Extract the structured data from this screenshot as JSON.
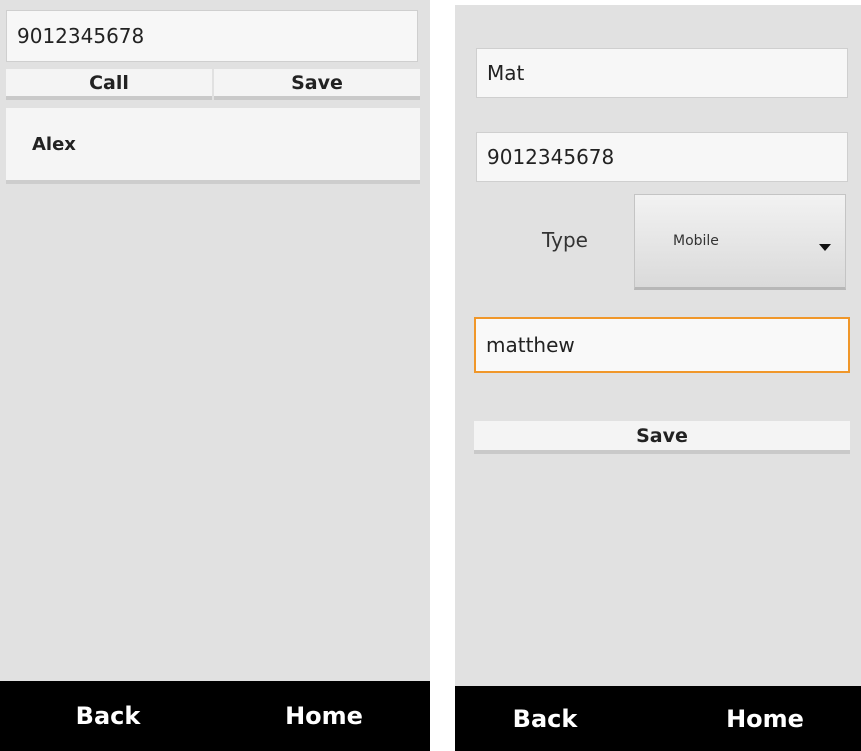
{
  "left_screen": {
    "phone_input": {
      "value": "9012345678"
    },
    "call_button": {
      "label": "Call"
    },
    "save_button": {
      "label": "Save"
    },
    "contacts": [
      {
        "name": "Alex"
      }
    ],
    "nav": {
      "back_label": "Back",
      "home_label": "Home"
    }
  },
  "right_screen": {
    "name_input": {
      "value": "Mat"
    },
    "phone_input": {
      "value": "9012345678"
    },
    "type_label": "Type",
    "type_spinner": {
      "selected": "Mobile",
      "icon": "dropdown-caret-icon"
    },
    "nickname_input": {
      "value": "matthew",
      "focused": true
    },
    "save_button": {
      "label": "Save"
    },
    "nav": {
      "back_label": "Back",
      "home_label": "Home"
    }
  },
  "colors": {
    "screen_bg": "#e1e1e1",
    "focus_border": "#f0972a",
    "nav_bg": "#000000",
    "nav_text": "#ffffff"
  }
}
